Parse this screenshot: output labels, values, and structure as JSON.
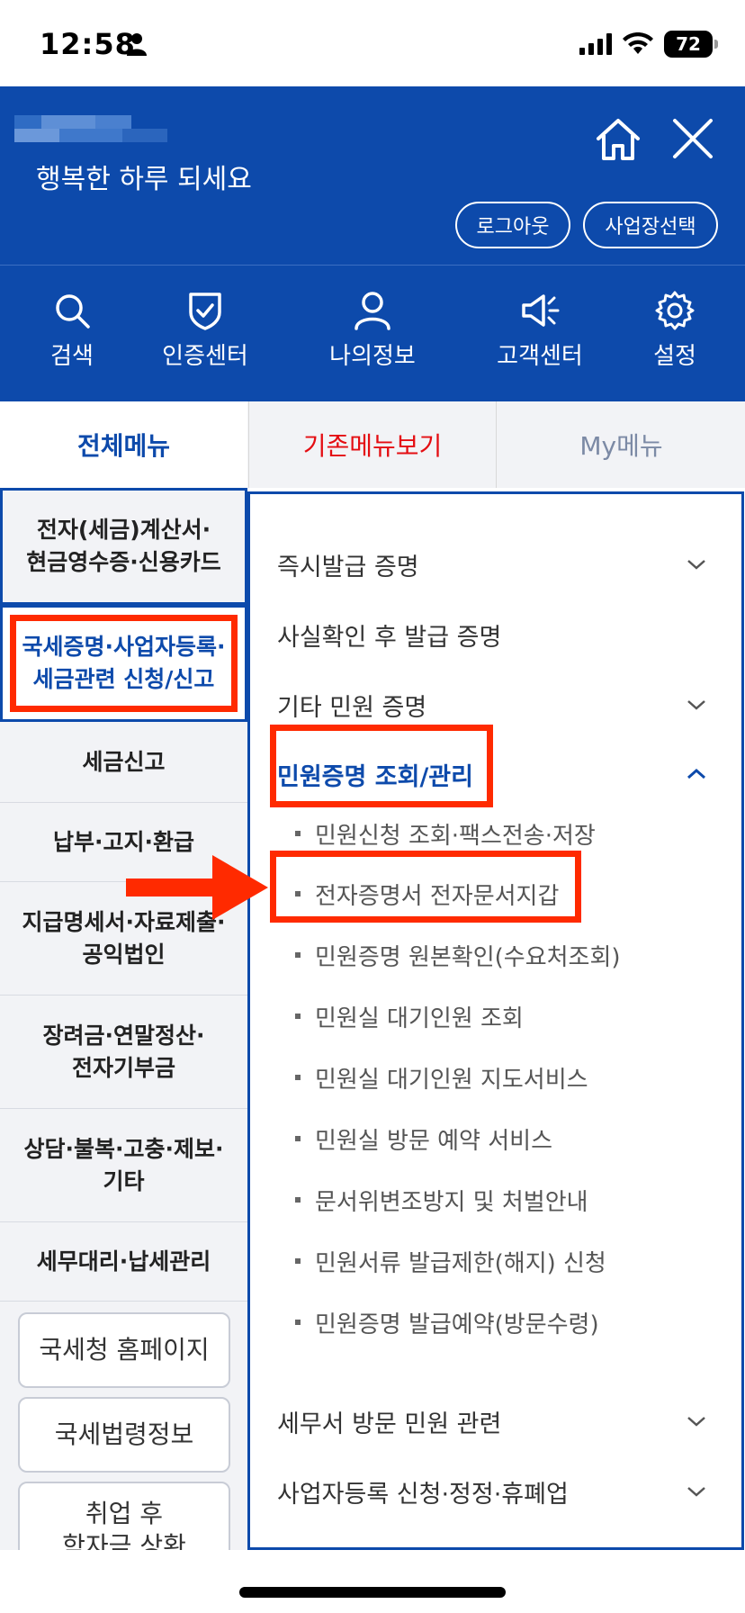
{
  "status_bar": {
    "time": "12:58",
    "battery": "72"
  },
  "header": {
    "greeting": "행복한 하루 되세요",
    "logout_label": "로그아웃",
    "business_select_label": "사업장선택",
    "bg_color": "#0d4aab"
  },
  "quick_nav": [
    {
      "label": "검색",
      "icon": "search-icon"
    },
    {
      "label": "인증센터",
      "icon": "shield-check-icon"
    },
    {
      "label": "나의정보",
      "icon": "person-icon"
    },
    {
      "label": "고객센터",
      "icon": "megaphone-icon"
    },
    {
      "label": "설정",
      "icon": "gear-icon"
    }
  ],
  "tabs": {
    "all": "전체메뉴",
    "old": "기존메뉴보기",
    "my": "My메뉴"
  },
  "left_menu": [
    {
      "label": "전자(세금)계산서·\n현금영수증·신용카드"
    },
    {
      "label": "국세증명·사업자등록·\n세금관련 신청/신고"
    },
    {
      "label": "세금신고"
    },
    {
      "label": "납부·고지·환급"
    },
    {
      "label": "지급명세서·자료제출·\n공익법인"
    },
    {
      "label": "장려금·연말정산·\n전자기부금"
    },
    {
      "label": "상담·불복·고충·제보·\n기타"
    },
    {
      "label": "세무대리·납세관리"
    }
  ],
  "left_buttons": [
    {
      "label": "국세청 홈페이지"
    },
    {
      "label": "국세법령정보"
    },
    {
      "label": "취업 후\n학자금 상환"
    }
  ],
  "right_menu": {
    "items": [
      {
        "label": "즉시발급 증명"
      },
      {
        "label": "사실확인 후 발급 증명"
      },
      {
        "label": "기타 민원 증명"
      },
      {
        "label": "민원증명 조회/관리"
      }
    ],
    "subitems": [
      {
        "label": "민원신청 조회·팩스전송·저장"
      },
      {
        "label": "전자증명서 전자문서지갑"
      },
      {
        "label": "민원증명 원본확인(수요처조회)"
      },
      {
        "label": "민원실 대기인원 조회"
      },
      {
        "label": "민원실 대기인원 지도서비스"
      },
      {
        "label": "민원실 방문 예약 서비스"
      },
      {
        "label": "문서위변조방지 및 처벌안내"
      },
      {
        "label": "민원서류 발급제한(해지) 신청"
      },
      {
        "label": "민원증명 발급예약(방문수령)"
      }
    ],
    "bottom_items": [
      {
        "label": "세무서 방문 민원 관련"
      },
      {
        "label": "사업자등록 신청·정정·휴폐업"
      }
    ]
  },
  "colors": {
    "primary": "#0d4aab",
    "highlight_red": "#ff2a00",
    "tab_old_red": "#e40d12"
  }
}
